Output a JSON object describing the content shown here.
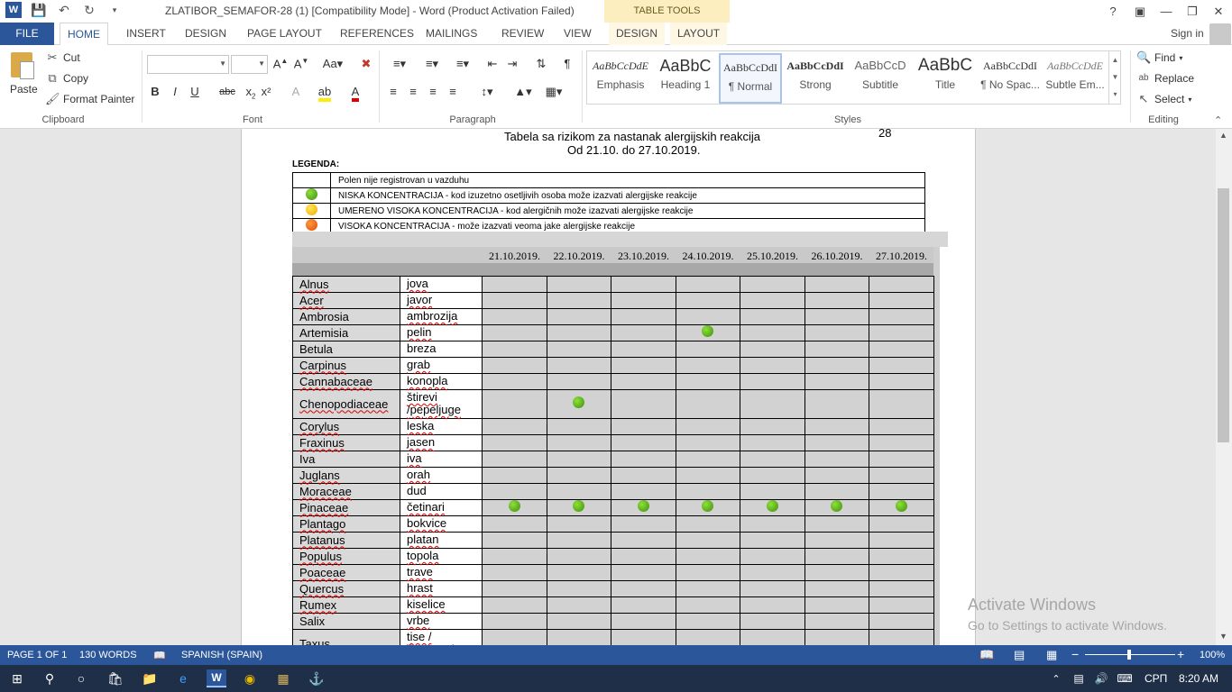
{
  "window": {
    "title": "ZLATIBOR_SEMAFOR-28 (1) [Compatibility Mode] - Word (Product Activation Failed)",
    "contextual_header": "TABLE TOOLS"
  },
  "tabs": {
    "file": "FILE",
    "items": [
      "HOME",
      "INSERT",
      "DESIGN",
      "PAGE LAYOUT",
      "REFERENCES",
      "MAILINGS",
      "REVIEW",
      "VIEW"
    ],
    "contextual": [
      "DESIGN",
      "LAYOUT"
    ],
    "signin": "Sign in"
  },
  "ribbon": {
    "clipboard": {
      "paste": "Paste",
      "cut": "Cut",
      "copy": "Copy",
      "format_painter": "Format Painter",
      "label": "Clipboard"
    },
    "font": {
      "label": "Font",
      "bold": "B",
      "italic": "I",
      "underline": "U",
      "strike": "abc",
      "super": "x²"
    },
    "paragraph": {
      "label": "Paragraph"
    },
    "styles": {
      "label": "Styles",
      "items": [
        {
          "sample": "AaBbCcDdE",
          "name": "Emphasis"
        },
        {
          "sample": "AaBbC",
          "name": "Heading 1"
        },
        {
          "sample": "AaBbCcDdI",
          "name": "¶ Normal"
        },
        {
          "sample": "AaBbCcDdI",
          "name": "Strong"
        },
        {
          "sample": "AaBbCcD",
          "name": "Subtitle"
        },
        {
          "sample": "AaBbC",
          "name": "Title"
        },
        {
          "sample": "AaBbCcDdI",
          "name": "¶ No Spac..."
        },
        {
          "sample": "AaBbCcDdE",
          "name": "Subtle Em..."
        }
      ]
    },
    "editing": {
      "label": "Editing",
      "find": "Find",
      "replace": "Replace",
      "select": "Select"
    }
  },
  "document": {
    "heading": "Tabela sa rizikom za nastanak alergijskih reakcija",
    "period": "Od 21.10. do 27.10.2019.",
    "week": "28",
    "legend_title": "LEGENDA:",
    "legend": [
      {
        "dot": "none",
        "text": "Polen nije registrovan u vazduhu"
      },
      {
        "dot": "green",
        "text": "NISKA KONCENTRACIJA - kod izuzetno osetljivih osoba može izazvati alergijske reakcije"
      },
      {
        "dot": "yellow",
        "text": "UMERENO VISOKA KONCENTRACIJA - kod alergičnih može izazvati alergijske reakcije"
      },
      {
        "dot": "orange",
        "text": "VISOKA KONCENTRACIJA - može izazvati veoma jake alergijske reakcije"
      }
    ],
    "dates": [
      "21.10.2019.",
      "22.10.2019.",
      "23.10.2019.",
      "24.10.2019.",
      "25.10.2019.",
      "26.10.2019.",
      "27.10.2019."
    ],
    "rows": [
      {
        "latin": "Alnus",
        "local": "jova",
        "marks": [
          0,
          0,
          0,
          0,
          0,
          0,
          0
        ]
      },
      {
        "latin": "Acer",
        "local": "javor",
        "marks": [
          0,
          0,
          0,
          0,
          0,
          0,
          0
        ]
      },
      {
        "latin": "Ambrosia",
        "local": "ambrozija",
        "marks": [
          0,
          0,
          0,
          0,
          0,
          0,
          0
        ]
      },
      {
        "latin": "Artemisia",
        "local": "pelin",
        "marks": [
          0,
          0,
          0,
          1,
          0,
          0,
          0
        ]
      },
      {
        "latin": "Betula",
        "local": "breza",
        "marks": [
          0,
          0,
          0,
          0,
          0,
          0,
          0
        ]
      },
      {
        "latin": "Carpinus",
        "local": "grab",
        "marks": [
          0,
          0,
          0,
          0,
          0,
          0,
          0
        ]
      },
      {
        "latin": "Cannabaceae",
        "local": "konopla",
        "marks": [
          0,
          0,
          0,
          0,
          0,
          0,
          0
        ]
      },
      {
        "latin": "Chenopodiaceae",
        "local": "štirevi /pepeljuge",
        "marks": [
          0,
          1,
          0,
          0,
          0,
          0,
          0
        ],
        "tall": true
      },
      {
        "latin": "Corylus",
        "local": "leska",
        "marks": [
          0,
          0,
          0,
          0,
          0,
          0,
          0
        ]
      },
      {
        "latin": "Fraxinus",
        "local": "jasen",
        "marks": [
          0,
          0,
          0,
          0,
          0,
          0,
          0
        ]
      },
      {
        "latin": "Iva",
        "local": "iva",
        "marks": [
          0,
          0,
          0,
          0,
          0,
          0,
          0
        ]
      },
      {
        "latin": "Juglans",
        "local": "orah",
        "marks": [
          0,
          0,
          0,
          0,
          0,
          0,
          0
        ]
      },
      {
        "latin": "Moraceae",
        "local": "dud",
        "marks": [
          0,
          0,
          0,
          0,
          0,
          0,
          0
        ]
      },
      {
        "latin": "Pinaceae",
        "local": "četinari",
        "marks": [
          1,
          1,
          1,
          1,
          1,
          1,
          1
        ]
      },
      {
        "latin": "Plantago",
        "local": "bokvice",
        "marks": [
          0,
          0,
          0,
          0,
          0,
          0,
          0
        ]
      },
      {
        "latin": "Platanus",
        "local": "platan",
        "marks": [
          0,
          0,
          0,
          0,
          0,
          0,
          0
        ]
      },
      {
        "latin": "Populus",
        "local": "topola",
        "marks": [
          0,
          0,
          0,
          0,
          0,
          0,
          0
        ]
      },
      {
        "latin": "Poaceae",
        "local": "trave",
        "marks": [
          0,
          0,
          0,
          0,
          0,
          0,
          0
        ]
      },
      {
        "latin": "Quercus",
        "local": "hrast",
        "marks": [
          0,
          0,
          0,
          0,
          0,
          0,
          0
        ]
      },
      {
        "latin": "Rumex",
        "local": "kiselice",
        "marks": [
          0,
          0,
          0,
          0,
          0,
          0,
          0
        ]
      },
      {
        "latin": "Salix",
        "local": "vrbe",
        "marks": [
          0,
          0,
          0,
          0,
          0,
          0,
          0
        ]
      },
      {
        "latin": "Taxus",
        "local": "tise / čempresi",
        "marks": [
          0,
          0,
          0,
          0,
          0,
          0,
          0
        ],
        "tall": true
      }
    ]
  },
  "watermark": {
    "line1": "Activate Windows",
    "line2": "Go to Settings to activate Windows."
  },
  "status": {
    "page": "PAGE 1 OF 1",
    "words": "130 WORDS",
    "language": "SPANISH (SPAIN)",
    "zoom": "100%"
  },
  "taskbar": {
    "lang": "СРП",
    "time": "8:20 AM"
  },
  "colors": {
    "word_blue": "#2b579a",
    "green_dot": "#5aa51a",
    "taskbar": "#1f2f48"
  }
}
